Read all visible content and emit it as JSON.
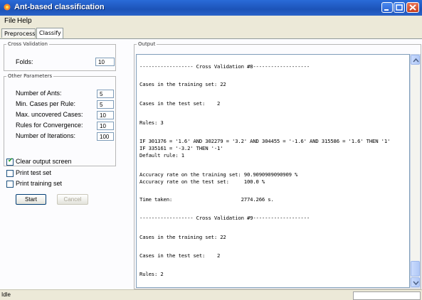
{
  "window": {
    "title": "Ant-based classification"
  },
  "menu": {
    "file": "File",
    "help": "Help"
  },
  "tabs": [
    {
      "label": "Preprocess",
      "active": false
    },
    {
      "label": "Classify",
      "active": true
    }
  ],
  "cross_validation": {
    "legend": "Cross Validation",
    "folds_label": "Folds:",
    "folds_value": "10"
  },
  "other_params": {
    "legend": "Other Parameters",
    "items": [
      {
        "label": "Number of Ants:",
        "value": "5"
      },
      {
        "label": "Min. Cases per Rule:",
        "value": "5"
      },
      {
        "label": "Max. uncovered Cases:",
        "value": "10"
      },
      {
        "label": "Rules for Convergence:",
        "value": "10"
      },
      {
        "label": "Number of Iterations:",
        "value": "100"
      }
    ]
  },
  "options": [
    {
      "label": "Clear output screen",
      "checked": true
    },
    {
      "label": "Print test set",
      "checked": false
    },
    {
      "label": "Print training set",
      "checked": false
    }
  ],
  "buttons": {
    "start": "Start",
    "cancel": "Cancel"
  },
  "output": {
    "legend": "Output",
    "lines": [
      "------------------ Cross Validation #8-------------------",
      "Cases in the training set: 22",
      "Cases in the test set:    2",
      "Rules: 3",
      "IF 301376 = '1.6' AND 302279 = '3.2' AND 304455 = '-1.6' AND 315586 = '1.6' THEN '1'",
      "IF 335161 = '-3.2' THEN '-1'",
      "Default rule: 1",
      "Accuracy rate on the training set: 90.9090909090909 %",
      "Accuracy rate on the test set:     100.0 %",
      "Time taken:                       2774.266 s.",
      "------------------ Cross Validation #9-------------------",
      "Cases in the training set: 22",
      "Cases in the test set:    2",
      "Rules: 2"
    ]
  },
  "status": {
    "text": "Idle"
  }
}
